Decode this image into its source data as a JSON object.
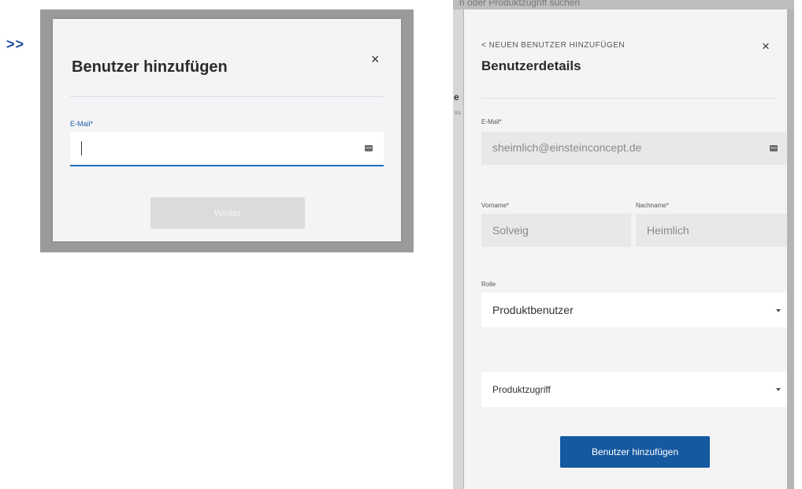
{
  "marker": ">>",
  "left_dialog": {
    "title": "Benutzer hinzufügen",
    "close": "×",
    "email_label": "E-Mail*",
    "email_value": "",
    "next_button": "Weiter"
  },
  "right_panel": {
    "background_text": "n oder Produktzugriff suchen",
    "background_letter": "e",
    "back_link": "< NEUEN BENUTZER HINZUFÜGEN",
    "title": "Benutzerdetails",
    "close": "×",
    "email_label": "E-Mail*",
    "email_value": "sheimlich@einsteinconcept.de",
    "firstname_label": "Vorname*",
    "firstname_value": "Solveig",
    "lastname_label": "Nachname*",
    "lastname_value": "Heimlich",
    "role_label": "Rolle",
    "role_value": "Produktbenutzer",
    "product_access_value": "Produktzugriff",
    "submit_button": "Benutzer hinzufügen"
  },
  "colors": {
    "accent": "#1559a0",
    "marker": "#1f4e9a",
    "input_focus": "#1f6fb8",
    "disabled_button": "#dbdbdd"
  }
}
